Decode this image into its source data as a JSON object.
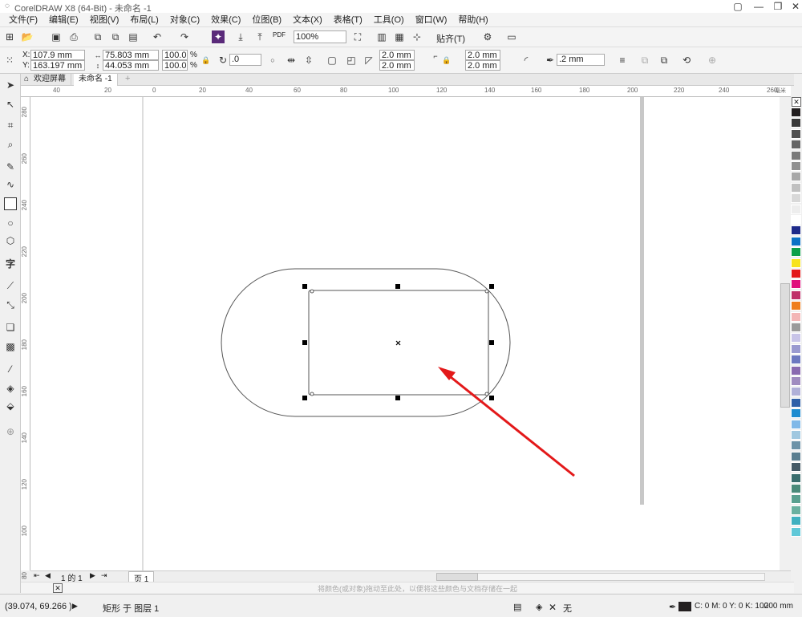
{
  "window": {
    "title": "CorelDRAW X8 (64-Bit) - 未命名 -1"
  },
  "menu": [
    "文件(F)",
    "编辑(E)",
    "视图(V)",
    "布局(L)",
    "对象(C)",
    "效果(C)",
    "位图(B)",
    "文本(X)",
    "表格(T)",
    "工具(O)",
    "窗口(W)",
    "帮助(H)"
  ],
  "standard_toolbar": {
    "zoom": "100%",
    "snap_label": "贴齐(T)",
    "pdf_label": "PDF"
  },
  "property_bar": {
    "x": "107.9 mm",
    "y": "163.197 mm",
    "width": "75.803 mm",
    "height": "44.053 mm",
    "scale_x": "100.0",
    "scale_y": "100.0",
    "pct": "%",
    "rotation": ".0",
    "corner_tl": "2.0 mm",
    "corner_bl": "2.0 mm",
    "corner_tr": "2.0 mm",
    "corner_br": "2.0 mm",
    "outline_width": ".2 mm"
  },
  "tabs": {
    "welcome": "欢迎屏幕",
    "document": "未命名 -1"
  },
  "ruler_h": [
    "40",
    "20",
    "0",
    "20",
    "40",
    "60",
    "80",
    "100",
    "120",
    "140",
    "160",
    "180",
    "200",
    "220",
    "240",
    "260"
  ],
  "ruler_unit": "毫米",
  "ruler_v": [
    "280",
    "260",
    "240",
    "220",
    "200",
    "180",
    "160",
    "140",
    "120",
    "100",
    "80"
  ],
  "page_nav": {
    "counter": "1 的 1",
    "page_tab": "页 1"
  },
  "color_hint": "将颜色(或对象)拖动至此处，以便将这些颜色与文档存储在一起",
  "status": {
    "coords": "(39.074, 69.266 )",
    "object_info": "矩形 于 图层 1",
    "fill_label": "无",
    "color_info": "C: 0 M: 0 Y: 0 K: 100",
    "outline_size": ".200 mm"
  },
  "colors": {
    "accent_arrow": "#e3191a",
    "selection_handle": "#000000"
  },
  "palette": [
    "#231f20",
    "#3a3a3a",
    "#505050",
    "#666666",
    "#7a7a7a",
    "#909090",
    "#a8a8a8",
    "#c0c0c0",
    "#d8d8d8",
    "#ededed",
    "#ffffff",
    "#1d2a8a",
    "#0b72c5",
    "#0ea04a",
    "#f7e31d",
    "#e3191a",
    "#e0107d",
    "#c0306a",
    "#ef7d1b",
    "#f3b6b6",
    "#9b9b9b",
    "#c8c4e8",
    "#9a9ad0",
    "#6d78c0",
    "#8a6ab0",
    "#a08cc0",
    "#b0b0d8",
    "#3060a8",
    "#1e8cd0",
    "#7fb8e8",
    "#a0c8e0",
    "#6d93a8",
    "#5a7e90",
    "#445a66",
    "#3a6e6e",
    "#4a8a7a",
    "#5aa090",
    "#6ab0a0",
    "#40b0c0",
    "#60c8d8"
  ]
}
